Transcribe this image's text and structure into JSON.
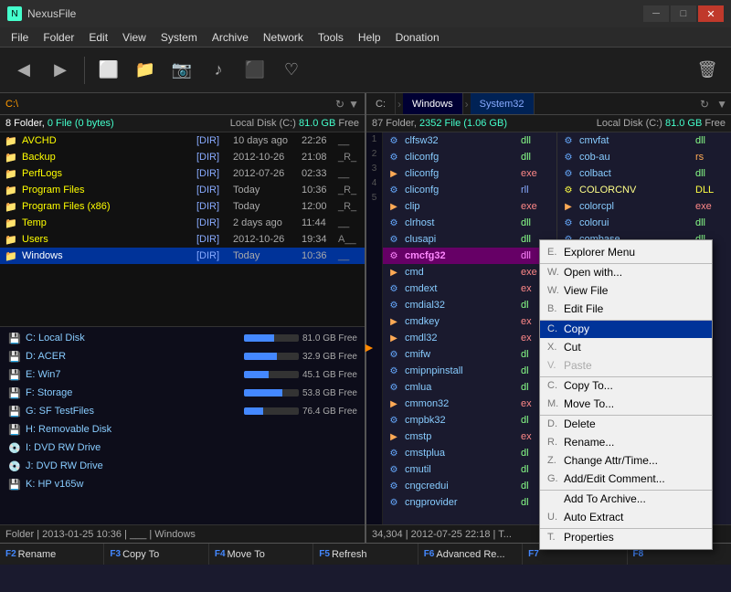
{
  "titleBar": {
    "icon": "N",
    "title": "NexusFile",
    "minBtn": "─",
    "maxBtn": "□",
    "closeBtn": "✕"
  },
  "menuBar": {
    "items": [
      "File",
      "Folder",
      "Edit",
      "View",
      "System",
      "Archive",
      "Network",
      "Tools",
      "Help",
      "Donation"
    ]
  },
  "toolbar": {
    "buttons": [
      "◀",
      "▶",
      "□",
      "📁",
      "📷",
      "♪",
      "⏹",
      "♡"
    ]
  },
  "leftPanel": {
    "addrBar": "C:\\",
    "folderCount": "8 Folder, 0 File (0 bytes)",
    "diskInfo": "Local Disk (C:)",
    "diskSize": "81.0 GB",
    "freeLabel": "Free",
    "files": [
      {
        "name": "AVCHD",
        "ext": "[DIR]",
        "size": "",
        "date": "10 days ago",
        "time": "22:26",
        "attr": "__"
      },
      {
        "name": "Backup",
        "ext": "[DIR]",
        "size": "",
        "date": "2012-10-26",
        "time": "21:08",
        "attr": "_R_"
      },
      {
        "name": "PerfLogs",
        "ext": "[DIR]",
        "size": "",
        "date": "2012-07-26",
        "time": "02:33",
        "attr": "__"
      },
      {
        "name": "Program Files",
        "ext": "[DIR]",
        "size": "",
        "date": "Today",
        "time": "10:36",
        "attr": "_R_"
      },
      {
        "name": "Program Files (x86)",
        "ext": "[DIR]",
        "size": "",
        "date": "Today",
        "time": "12:00",
        "attr": "_R_"
      },
      {
        "name": "Temp",
        "ext": "[DIR]",
        "size": "",
        "date": "2 days ago",
        "time": "11:44",
        "attr": "__"
      },
      {
        "name": "Users",
        "ext": "[DIR]",
        "size": "",
        "date": "2012-10-26",
        "time": "19:34",
        "attr": "A__"
      },
      {
        "name": "Windows",
        "ext": "[DIR]",
        "size": "",
        "date": "Today",
        "time": "10:36",
        "attr": "__"
      }
    ],
    "drives": [
      {
        "label": "C: Local Disk",
        "pct": 55,
        "free": "81.0 GB Free"
      },
      {
        "label": "D: ACER",
        "pct": 60,
        "free": "32.9 GB Free"
      },
      {
        "label": "E: Win7",
        "pct": 45,
        "free": "45.1 GB Free"
      },
      {
        "label": "F: Storage",
        "pct": 70,
        "free": "53.8 GB Free"
      },
      {
        "label": "G: SF TestFiles",
        "pct": 35,
        "free": "76.4 GB Free"
      },
      {
        "label": "H: Removable Disk",
        "pct": 0,
        "free": ""
      },
      {
        "label": "I: DVD RW Drive",
        "pct": 0,
        "free": ""
      },
      {
        "label": "J: DVD RW Drive",
        "pct": 0,
        "free": ""
      },
      {
        "label": "K: HP v165w",
        "pct": 0,
        "free": ""
      }
    ],
    "statusBar": "Folder | 2013-01-25 10:36 | ___ | Windows"
  },
  "rightPanel": {
    "breadcrumbs": [
      "C:",
      "Windows",
      "System32"
    ],
    "folderCount": "87 Folder, 2352 File (1.06 GB)",
    "diskInfo": "Local Disk (C:)",
    "diskSize": "81.0 GB",
    "freeLabel": "Free",
    "lineNums": [
      "1",
      "2",
      "3",
      "4",
      "5"
    ],
    "filesLeft": [
      {
        "name": "clfsw32",
        "ext": "dll",
        "extClass": "dll-ext"
      },
      {
        "name": "cliconfg",
        "ext": "dll",
        "extClass": "dll-ext"
      },
      {
        "name": "cliconfg",
        "ext": "exe",
        "extClass": "exe-ext"
      },
      {
        "name": "cliconfg",
        "ext": "rll",
        "extClass": "rll-ext"
      },
      {
        "name": "clip",
        "ext": "exe",
        "extClass": "exe-ext"
      },
      {
        "name": "clrhost",
        "ext": "dll",
        "extClass": "dll-ext"
      },
      {
        "name": "clusapi",
        "ext": "dll",
        "extClass": "dll-ext"
      },
      {
        "name": "cmcfg32",
        "ext": "dll",
        "extClass": "dll-ext",
        "selected": true
      },
      {
        "name": "cmd",
        "ext": "exe",
        "extClass": "exe-ext"
      },
      {
        "name": "cmdext",
        "ext": "ex",
        "extClass": "exe-ext"
      },
      {
        "name": "cmdial32",
        "ext": "dl",
        "extClass": "dll-ext"
      },
      {
        "name": "cmdkey",
        "ext": "ex",
        "extClass": "exe-ext"
      },
      {
        "name": "cmdl32",
        "ext": "ex",
        "extClass": "exe-ext"
      },
      {
        "name": "cmifw",
        "ext": "dl",
        "extClass": "dll-ext"
      },
      {
        "name": "cmipnpinstall",
        "ext": "dl",
        "extClass": "dll-ext"
      },
      {
        "name": "cmlua",
        "ext": "dl",
        "extClass": "dll-ext"
      },
      {
        "name": "cmmon32",
        "ext": "ex",
        "extClass": "exe-ext"
      },
      {
        "name": "cmpbk32",
        "ext": "dl",
        "extClass": "dll-ext"
      },
      {
        "name": "cmstp",
        "ext": "ex",
        "extClass": "exe-ext"
      },
      {
        "name": "cmstplua",
        "ext": "dl",
        "extClass": "dll-ext"
      },
      {
        "name": "cmutil",
        "ext": "dl",
        "extClass": "dll-ext"
      },
      {
        "name": "cngcredui",
        "ext": "dl",
        "extClass": "dll-ext"
      },
      {
        "name": "cngprovider",
        "ext": "dl",
        "extClass": "dll-ext"
      }
    ],
    "filesRight": [
      {
        "name": "cmvfat",
        "ext": "dll",
        "extClass": "dll-ext"
      },
      {
        "name": "cob-au",
        "ext": "rs",
        "extClass": "rs-ext"
      },
      {
        "name": "colbact",
        "ext": "dll",
        "extClass": "dll-ext"
      },
      {
        "name": "COLORCNV",
        "ext": "DLL",
        "extClass": "DLL-ext"
      },
      {
        "name": "colorcpl",
        "ext": "exe",
        "extClass": "exe-ext"
      },
      {
        "name": "colorui",
        "ext": "dll",
        "extClass": "dll-ext"
      },
      {
        "name": "combase",
        "ext": "dll",
        "extClass": "dll-ext"
      }
    ],
    "statusBar": "34,304 | 2012-07-25 22:18 | T..."
  },
  "contextMenu": {
    "items": [
      {
        "key": "E.",
        "label": "Explorer Menu",
        "separator": false
      },
      {
        "key": "W.",
        "label": "Open with...",
        "separator": true
      },
      {
        "key": "W.",
        "label": "View File",
        "separator": false
      },
      {
        "key": "B.",
        "label": "Edit File",
        "separator": false
      },
      {
        "key": "C.",
        "label": "Copy",
        "separator": true
      },
      {
        "key": "X.",
        "label": "Cut",
        "separator": false
      },
      {
        "key": "V.",
        "label": "Paste",
        "separator": false
      },
      {
        "key": "C.",
        "label": "Copy To...",
        "separator": true
      },
      {
        "key": "M.",
        "label": "Move To...",
        "separator": false
      },
      {
        "key": "D.",
        "label": "Delete",
        "separator": true
      },
      {
        "key": "R.",
        "label": "Rename...",
        "separator": false
      },
      {
        "key": "Z.",
        "label": "Change Attr/Time...",
        "separator": false
      },
      {
        "key": "G.",
        "label": "Add/Edit Comment...",
        "separator": false
      },
      {
        "key": "",
        "label": "Add To Archive...",
        "separator": true
      },
      {
        "key": "U.",
        "label": "Auto Extract",
        "separator": false
      },
      {
        "key": "T.",
        "label": "Properties",
        "separator": true
      }
    ]
  },
  "bottomBar": {
    "buttons": [
      {
        "key": "F2",
        "label": "Rename"
      },
      {
        "key": "F3",
        "label": "Copy To"
      },
      {
        "key": "F4",
        "label": "Move To"
      },
      {
        "key": "F5",
        "label": "Refresh"
      },
      {
        "key": "F6",
        "label": "Advanced Re..."
      },
      {
        "key": "F7",
        "label": ""
      },
      {
        "key": "F8",
        "label": ""
      }
    ]
  }
}
